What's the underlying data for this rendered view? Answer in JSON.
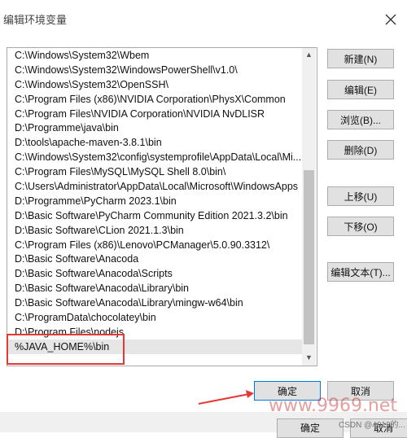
{
  "window": {
    "title": "编辑环境变量"
  },
  "list": {
    "items": [
      "C:\\Windows\\System32\\Wbem",
      "C:\\Windows\\System32\\WindowsPowerShell\\v1.0\\",
      "C:\\Windows\\System32\\OpenSSH\\",
      "C:\\Program Files (x86)\\NVIDIA Corporation\\PhysX\\Common",
      "C:\\Program Files\\NVIDIA Corporation\\NVIDIA NvDLISR",
      "D:\\Programme\\java\\bin",
      "D:\\tools\\apache-maven-3.8.1\\bin",
      "C:\\Windows\\System32\\config\\systemprofile\\AppData\\Local\\Mi...",
      "C:\\Program Files\\MySQL\\MySQL Shell 8.0\\bin\\",
      "C:\\Users\\Administrator\\AppData\\Local\\Microsoft\\WindowsApps",
      "D:\\Programme\\PyCharm 2023.1\\bin",
      "D:\\Basic Software\\PyCharm Community Edition 2021.3.2\\bin",
      "D:\\Basic Software\\CLion 2021.1.3\\bin",
      "C:\\Program Files (x86)\\Lenovo\\PCManager\\5.0.90.3312\\",
      "D:\\Basic Software\\Anacoda",
      "D:\\Basic Software\\Anacoda\\Scripts",
      "D:\\Basic Software\\Anacoda\\Library\\bin",
      "D:\\Basic Software\\Anacoda\\Library\\mingw-w64\\bin",
      "C:\\ProgramData\\chocolatey\\bin",
      "D:\\Program Files\\nodejs",
      "%JAVA_HOME%\\bin"
    ],
    "selected_index": 20
  },
  "buttons": {
    "new": "新建(N)",
    "edit": "编辑(E)",
    "browse": "浏览(B)...",
    "delete": "删除(D)",
    "move_up": "上移(U)",
    "move_down": "下移(O)",
    "edit_text": "编辑文本(T)...",
    "ok": "确定",
    "cancel": "取消"
  },
  "behind_dialog": {
    "ok": "确定",
    "cancel": "取消"
  },
  "watermark": {
    "text": "www.9969.net",
    "credit": "CSDN @4012的..."
  },
  "colors": {
    "highlight": "#e53935",
    "focus_border": "#0078d7"
  }
}
